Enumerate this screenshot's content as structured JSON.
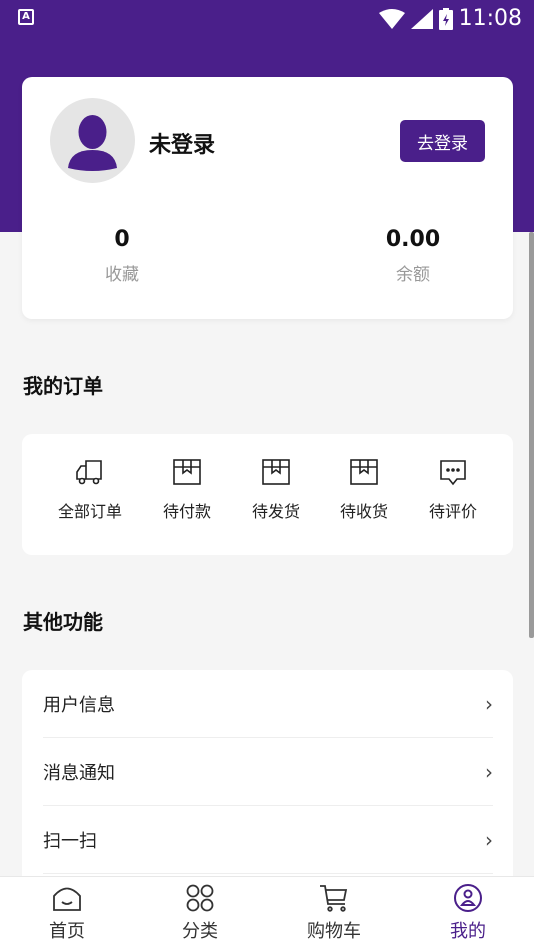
{
  "status_bar": {
    "time": "11:08",
    "left_badge": "A"
  },
  "profile": {
    "username": "未登录",
    "login_button": "去登录",
    "favorites": {
      "value": "0",
      "label": "收藏"
    },
    "balance": {
      "value": "0.00",
      "label": "余额"
    }
  },
  "orders": {
    "title": "我的订单",
    "items": [
      {
        "label": "全部订单",
        "icon": "truck-icon"
      },
      {
        "label": "待付款",
        "icon": "box-icon"
      },
      {
        "label": "待发货",
        "icon": "box-icon"
      },
      {
        "label": "待收货",
        "icon": "box-icon"
      },
      {
        "label": "待评价",
        "icon": "chat-icon"
      }
    ]
  },
  "functions": {
    "title": "其他功能",
    "items": [
      {
        "label": "用户信息"
      },
      {
        "label": "消息通知"
      },
      {
        "label": "扫一扫"
      }
    ],
    "chevron": "›"
  },
  "tabs": [
    {
      "label": "首页",
      "icon": "home-icon"
    },
    {
      "label": "分类",
      "icon": "category-icon"
    },
    {
      "label": "购物车",
      "icon": "cart-icon"
    },
    {
      "label": "我的",
      "icon": "user-icon",
      "active": true
    }
  ],
  "colors": {
    "primary": "#4a1f8a",
    "background": "#f5f5f5"
  }
}
